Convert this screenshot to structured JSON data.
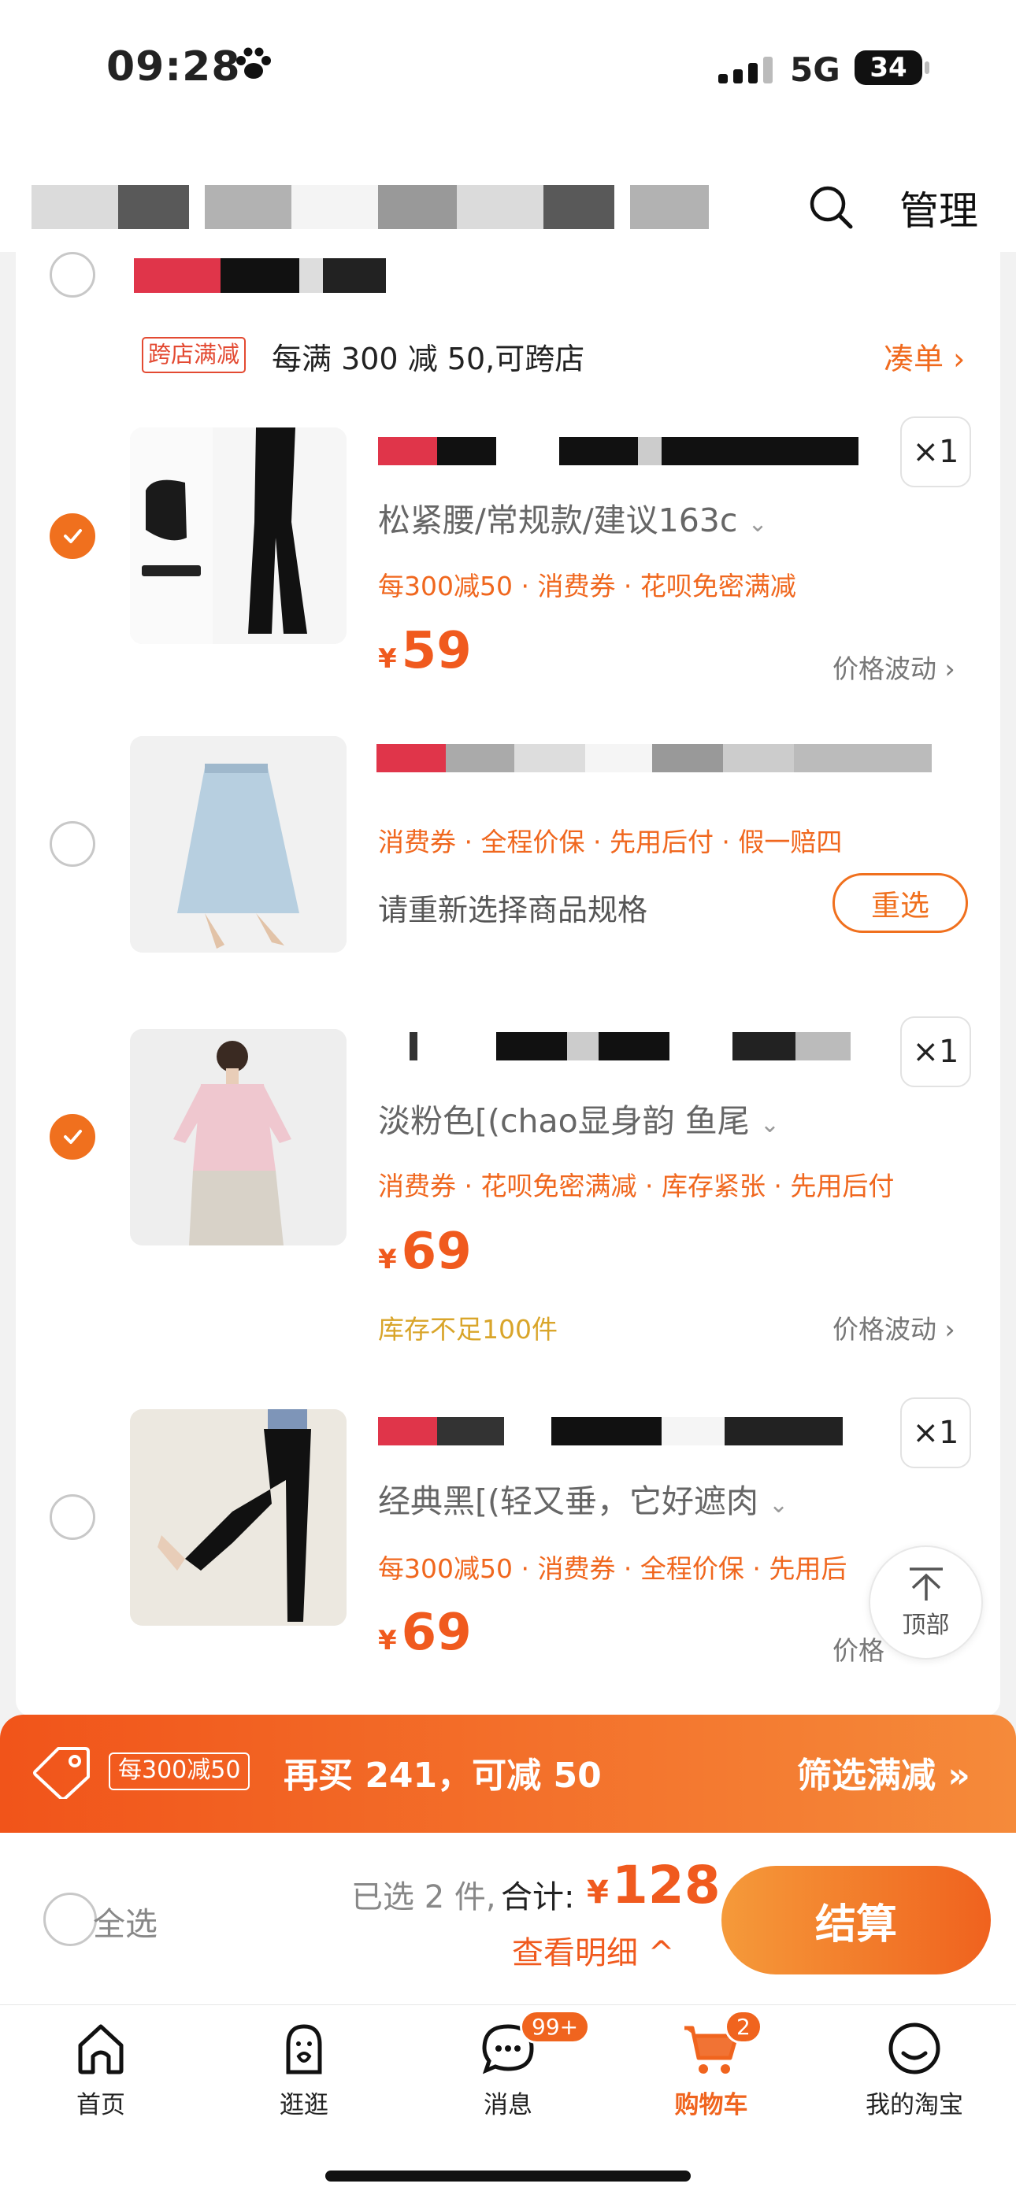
{
  "status_bar": {
    "time": "09:28",
    "network": "5G",
    "battery": "34"
  },
  "header": {
    "manage_label": "管理"
  },
  "store": {
    "promo_tag": "跨店满减",
    "promo_text": "每满 300 减 50,可跨店",
    "collect_label": "凑单 ›"
  },
  "items": [
    {
      "spec": "松紧腰/常规款/建议163c",
      "tags": "每300减50 · 消费券 · 花呗免密满减",
      "price": "59",
      "currency": "¥",
      "qty": "×1",
      "fluct": "价格波动 ›",
      "checked": true
    },
    {
      "tags": "消费券 · 全程价保 · 先用后付 · 假一赔四",
      "notice": "请重新选择商品规格",
      "reselect": "重选",
      "checked": false
    },
    {
      "spec": "淡粉色[(chao显身韵 鱼尾",
      "tags": "消费券 · 花呗免密满减 · 库存紧张 · 先用后付",
      "price": "69",
      "currency": "¥",
      "qty": "×1",
      "stock": "库存不足100件",
      "fluct": "价格波动 ›",
      "checked": true
    },
    {
      "spec": "经典黑[(轻又垂，它好遮肉",
      "tags": "每300减50 · 消费券 · 全程价保 · 先用后",
      "price": "69",
      "currency": "¥",
      "qty": "×1",
      "fluct": "价格",
      "checked": false
    }
  ],
  "back_to_top": "顶部",
  "promo_bar": {
    "tag": "每300减50",
    "text": "再买 241，可减 50",
    "filter": "筛选满减 »"
  },
  "checkout": {
    "select_all": "全选",
    "selected": "已选 2 件,",
    "total_label": "合计:",
    "currency": "¥",
    "total": "128",
    "detail": "查看明细 ^",
    "pay": "结算"
  },
  "tabs": [
    {
      "label": "首页",
      "icon": "home-icon"
    },
    {
      "label": "逛逛",
      "icon": "browse-icon"
    },
    {
      "label": "消息",
      "icon": "message-icon",
      "badge": "99+"
    },
    {
      "label": "购物车",
      "icon": "cart-icon",
      "badge": "2",
      "active": true
    },
    {
      "label": "我的淘宝",
      "icon": "profile-icon"
    }
  ],
  "colors": {
    "accent": "#f0641e",
    "promo_start": "#f1541a",
    "promo_end": "#f58a3a"
  }
}
